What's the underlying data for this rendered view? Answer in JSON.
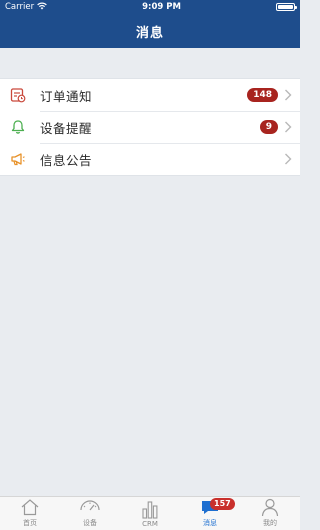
{
  "status_bar": {
    "carrier": "Carrier",
    "time": "9:09 PM"
  },
  "nav": {
    "title": "消息"
  },
  "list": {
    "items": [
      {
        "label": "订单通知",
        "badge": "148",
        "icon": "order-notice-icon"
      },
      {
        "label": "设备提醒",
        "badge": "9",
        "icon": "bell-icon"
      },
      {
        "label": "信息公告",
        "badge": "",
        "icon": "megaphone-icon"
      }
    ]
  },
  "tabbar": {
    "items": [
      {
        "label": "首页",
        "icon": "home-icon"
      },
      {
        "label": "设备",
        "icon": "gauge-icon"
      },
      {
        "label": "CRM",
        "icon": "bar-chart-icon"
      },
      {
        "label": "消息",
        "icon": "message-icon",
        "badge": "157",
        "active": true
      },
      {
        "label": "我的",
        "icon": "person-icon"
      }
    ]
  },
  "colors": {
    "header": "#1e4d8c",
    "badge": "#a8241f",
    "tab_active": "#1e6fd0",
    "order_icon": "#c9483b",
    "bell_icon": "#4caf50",
    "megaphone_icon": "#e8922a"
  }
}
